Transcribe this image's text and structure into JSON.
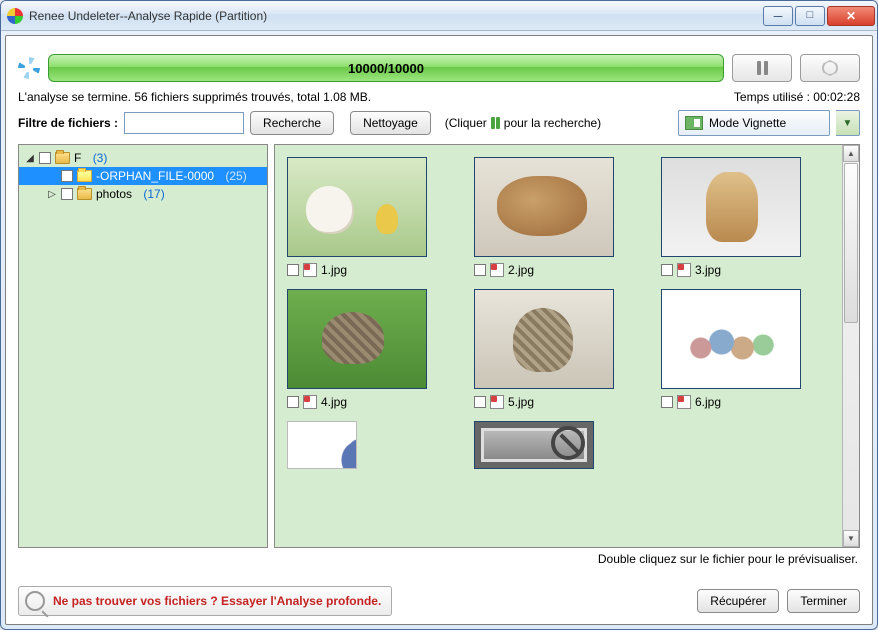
{
  "window": {
    "title": "Renee Undeleter--Analyse Rapide (Partition)"
  },
  "progress": {
    "text": "10000/10000"
  },
  "status": {
    "left": "L'analyse se termine. 56 fichiers supprimés trouvés, total 1.08 MB.",
    "right": "Temps utilisé : 00:02:28"
  },
  "filter": {
    "label": "Filtre de fichiers :",
    "value": "",
    "search_btn": "Recherche",
    "clear_btn": "Nettoyage",
    "hint_left": "(Cliquer",
    "hint_right": "pour la recherche)"
  },
  "view": {
    "mode": "Mode Vignette"
  },
  "tree": {
    "root": {
      "label": "F",
      "count": "(3)"
    },
    "orphan": {
      "label": "-ORPHAN_FILE-0000",
      "count": "(25)"
    },
    "photos": {
      "label": "photos",
      "count": "(17)"
    }
  },
  "files": {
    "f1": "1.jpg",
    "f2": "2.jpg",
    "f3": "3.jpg",
    "f4": "4.jpg",
    "f5": "5.jpg",
    "f6": "6.jpg"
  },
  "preview_hint": "Double cliquez sur le fichier pour le prévisualiser.",
  "deepscan": {
    "text": "Ne pas trouver vos fichiers ? Essayer l'Analyse profonde."
  },
  "buttons": {
    "recover": "Récupérer",
    "finish": "Terminer"
  }
}
